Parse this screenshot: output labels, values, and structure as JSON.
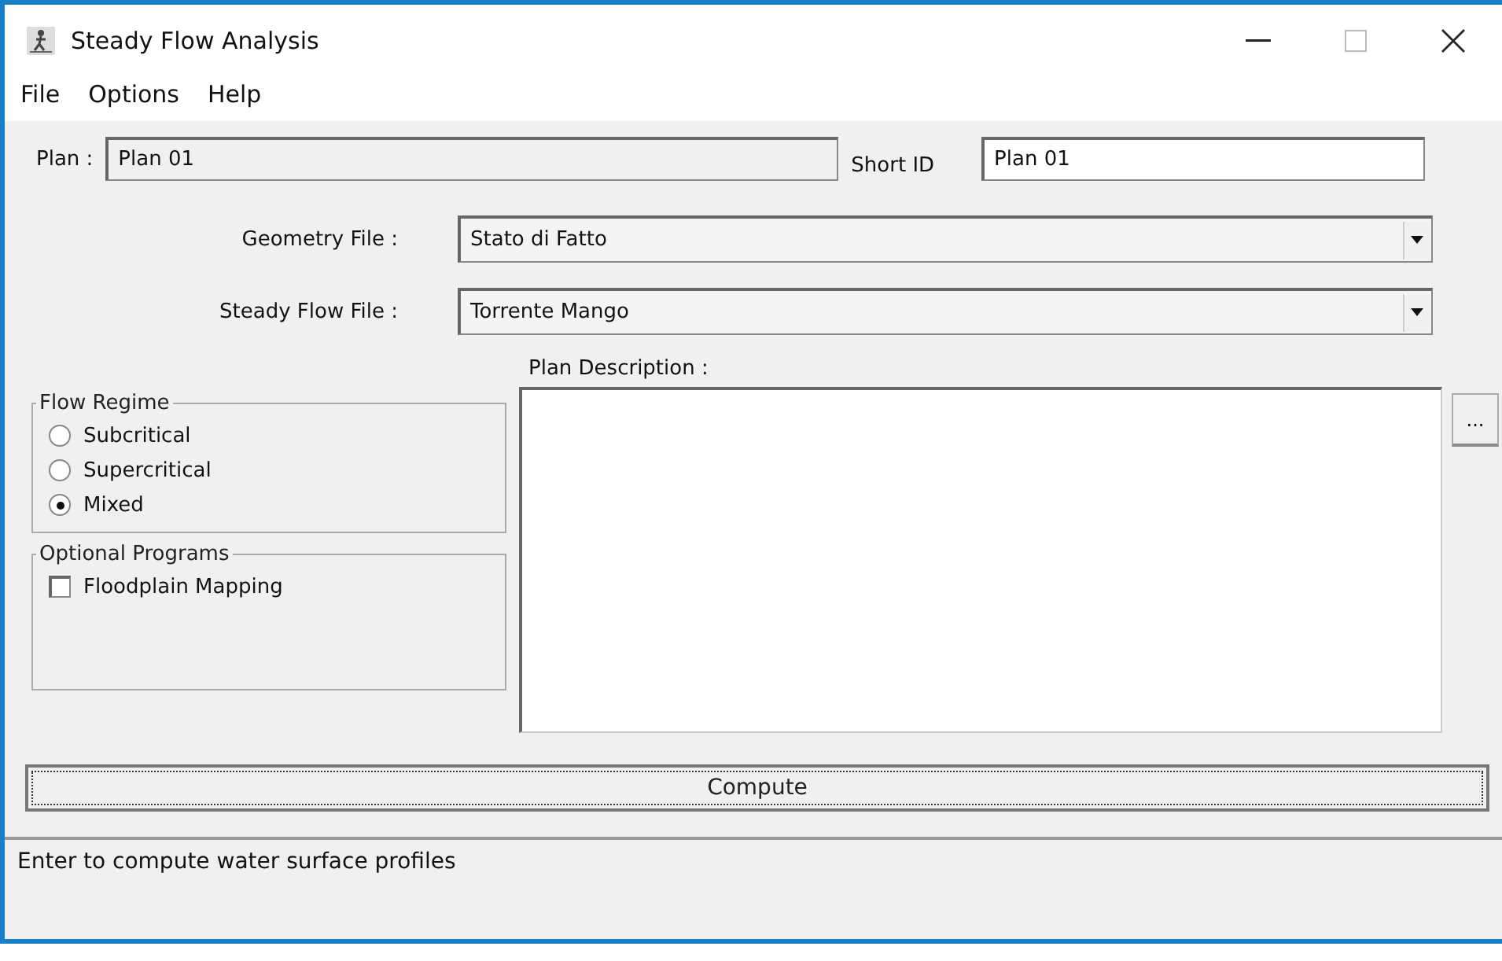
{
  "window": {
    "title": "Steady Flow Analysis"
  },
  "menu": [
    "File",
    "Options",
    "Help"
  ],
  "plan": {
    "label": "Plan :",
    "value": "Plan 01",
    "short_id_label": "Short ID",
    "short_id_value": "Plan 01"
  },
  "geometry_file": {
    "label": "Geometry File :",
    "value": "Stato di Fatto"
  },
  "steady_flow_file": {
    "label": "Steady Flow File :",
    "value": "Torrente Mango"
  },
  "flow_regime": {
    "title": "Flow Regime",
    "options": [
      {
        "label": "Subcritical",
        "selected": false
      },
      {
        "label": "Supercritical",
        "selected": false
      },
      {
        "label": "Mixed",
        "selected": true
      }
    ]
  },
  "optional_programs": {
    "title": "Optional Programs",
    "items": [
      {
        "label": "Floodplain Mapping",
        "checked": false
      }
    ]
  },
  "plan_description": {
    "label": "Plan Description :",
    "browse_button": "..."
  },
  "compute_button": "Compute",
  "status_bar": "Enter to compute water surface profiles"
}
